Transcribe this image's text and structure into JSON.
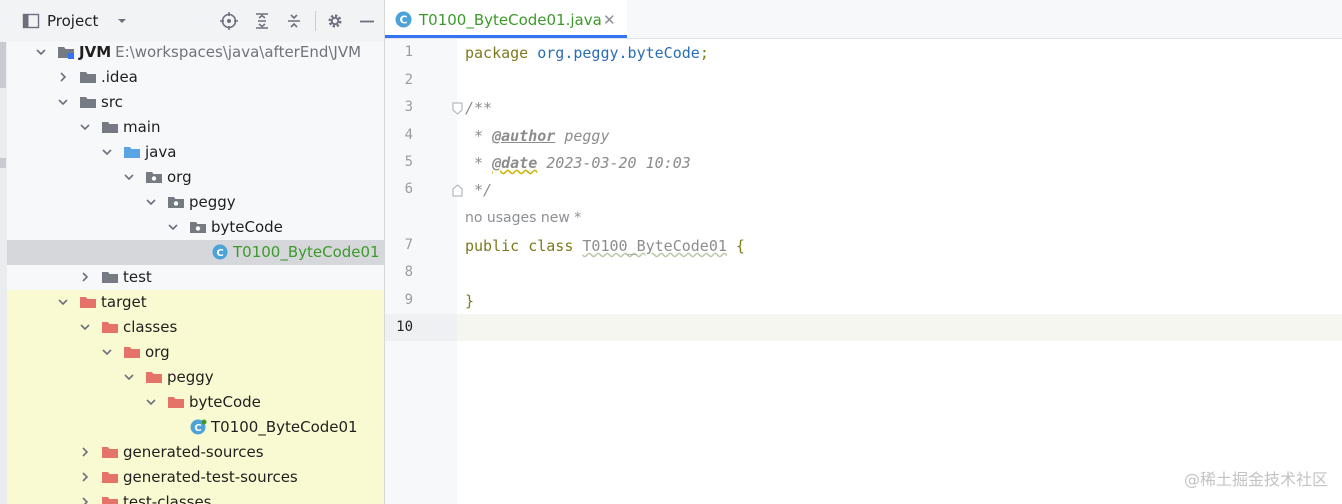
{
  "project_panel": {
    "title": "Project",
    "tree": [
      {
        "label": "JVM",
        "path": "E:\\workspaces\\java\\afterEnd\\JVM",
        "depth": 0,
        "expanded": true,
        "icon": "module-folder-icon",
        "bold": true
      },
      {
        "label": ".idea",
        "depth": 1,
        "expanded": false,
        "icon": "folder-icon"
      },
      {
        "label": "src",
        "depth": 1,
        "expanded": true,
        "icon": "folder-icon"
      },
      {
        "label": "main",
        "depth": 2,
        "expanded": true,
        "icon": "folder-icon"
      },
      {
        "label": "java",
        "depth": 3,
        "expanded": true,
        "icon": "source-root-icon"
      },
      {
        "label": "org",
        "depth": 4,
        "expanded": true,
        "icon": "package-icon"
      },
      {
        "label": "peggy",
        "depth": 5,
        "expanded": true,
        "icon": "package-icon"
      },
      {
        "label": "byteCode",
        "depth": 6,
        "expanded": true,
        "icon": "package-icon"
      },
      {
        "label": "T0100_ByteCode01",
        "depth": 7,
        "icon": "java-class-icon",
        "selected": true,
        "green": true
      },
      {
        "label": "test",
        "depth": 2,
        "expanded": false,
        "icon": "folder-icon"
      },
      {
        "label": "target",
        "depth": 1,
        "expanded": true,
        "icon": "excluded-folder-icon",
        "excluded": true
      },
      {
        "label": "classes",
        "depth": 2,
        "expanded": true,
        "icon": "excluded-folder-icon",
        "excluded": true
      },
      {
        "label": "org",
        "depth": 3,
        "expanded": true,
        "icon": "excluded-folder-icon",
        "excluded": true
      },
      {
        "label": "peggy",
        "depth": 4,
        "expanded": true,
        "icon": "excluded-folder-icon",
        "excluded": true
      },
      {
        "label": "byteCode",
        "depth": 5,
        "expanded": true,
        "icon": "excluded-folder-icon",
        "excluded": true
      },
      {
        "label": "T0100_ByteCode01",
        "depth": 6,
        "icon": "compiled-class-icon",
        "excluded": true
      },
      {
        "label": "generated-sources",
        "depth": 2,
        "expanded": false,
        "icon": "excluded-folder-icon",
        "excluded": true
      },
      {
        "label": "generated-test-sources",
        "depth": 2,
        "expanded": false,
        "icon": "excluded-folder-icon",
        "excluded": true
      },
      {
        "label": "test-classes",
        "depth": 2,
        "expanded": false,
        "icon": "excluded-folder-icon",
        "excluded": true
      }
    ]
  },
  "editor": {
    "tab_label": "T0100_ByteCode01.java",
    "tab_close": "✕",
    "current_line": "10",
    "line_numbers": [
      "1",
      "2",
      "3",
      "4",
      "5",
      "6",
      "7",
      "8",
      "9",
      "10"
    ],
    "code": {
      "l1_kw": "package",
      "l1_pkg": "org.peggy.byteCode",
      "l1_end": ";",
      "l3": "/**",
      "l4_star": " * ",
      "l4_tag": "@author",
      "l4_val": " peggy",
      "l5_star": " * ",
      "l5_tag": "@date",
      "l5_val": " 2023-03-20 10:03",
      "l6": " */",
      "l7_kw": "public class ",
      "l7_cls": "T0100_ByteCode01",
      "l7_end": " {",
      "l9": "}"
    },
    "inlay_hint": "no usages   new *"
  },
  "watermark": "@稀土掘金技术社区",
  "colors": {
    "excluded_bg": "#fafad2",
    "selected_bg": "#d5d7db",
    "accent": "#3574f0",
    "green_text": "#3c9a2a",
    "excluded_folder": "#e6736a"
  }
}
